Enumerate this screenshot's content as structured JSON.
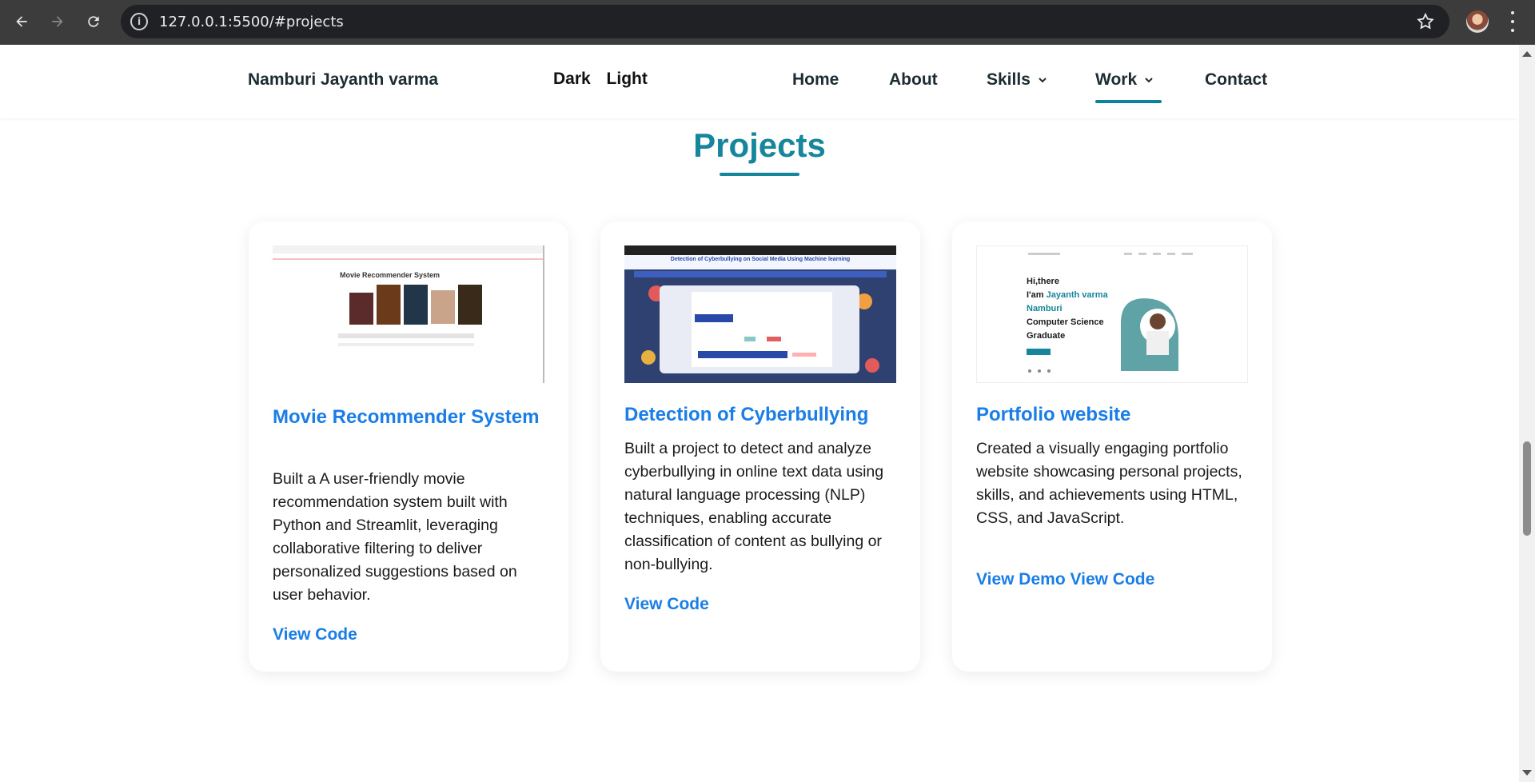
{
  "browser": {
    "url": "127.0.0.1:5500/#projects"
  },
  "header": {
    "logo": "Namburi Jayanth varma",
    "theme_dark": "Dark",
    "theme_light": "Light",
    "nav": [
      {
        "label": "Home",
        "dropdown": false,
        "active": false
      },
      {
        "label": "About",
        "dropdown": false,
        "active": false
      },
      {
        "label": "Skills",
        "dropdown": true,
        "active": false
      },
      {
        "label": "Work",
        "dropdown": true,
        "active": true
      },
      {
        "label": "Contact",
        "dropdown": false,
        "active": false
      }
    ]
  },
  "section": {
    "title": "Projects"
  },
  "projects": [
    {
      "title": "Movie Recommender System",
      "description": "Built a A user-friendly movie recommendation system built with Python and Streamlit, leveraging collaborative filtering to deliver personalized suggestions based on user behavior.",
      "links": [
        "View Code"
      ],
      "thumbnail": {
        "heading": "Movie Recommender System"
      }
    },
    {
      "title": "Detection of Cyberbullying",
      "description": "Built a project to detect and analyze cyberbullying in online text data using natural language processing (NLP) techniques, enabling accurate classification of content as bullying or non-bullying.",
      "links": [
        "View Code"
      ],
      "thumbnail": {
        "heading": "Detection of Cyberbullying on Social Media Using Machine learning"
      }
    },
    {
      "title": "Portfolio website",
      "description": "Created a visually engaging portfolio website showcasing personal projects, skills, and achievements using HTML, CSS, and JavaScript.",
      "links": [
        "View Demo",
        "View Code"
      ],
      "thumbnail": {
        "greeting": "Hi,there",
        "intro_prefix": "I'am",
        "name": "Jayanth varma Namburi",
        "role": "Computer Science Graduate"
      }
    }
  ],
  "colors": {
    "accent_teal": "#15869b",
    "link_blue": "#1a7ee6",
    "chrome_bg": "#3c3c3c"
  }
}
